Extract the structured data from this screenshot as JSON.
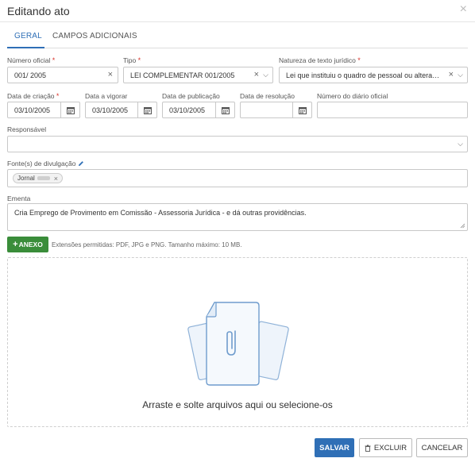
{
  "modal": {
    "title": "Editando ato",
    "close_icon": "×"
  },
  "tabs": [
    {
      "label": "GERAL"
    },
    {
      "label": "CAMPOS ADICIONAIS"
    }
  ],
  "fields": {
    "numero_oficial": {
      "label": "Número oficial",
      "value": "001/ 2005"
    },
    "tipo": {
      "label": "Tipo",
      "value": "LEI COMPLEMENTAR 001/2005"
    },
    "natureza": {
      "label": "Natureza de texto jurídico",
      "value": "Lei que instituiu o quadro de pessoal ou alteraç..."
    },
    "data_criacao": {
      "label": "Data de criação",
      "value": "03/10/2005"
    },
    "data_vigorar": {
      "label": "Data a vigorar",
      "value": "03/10/2005"
    },
    "data_publicacao": {
      "label": "Data de publicação",
      "value": "03/10/2005"
    },
    "data_resolucao": {
      "label": "Data de resolução",
      "value": ""
    },
    "numero_diario": {
      "label": "Número do diário oficial",
      "value": ""
    },
    "responsavel": {
      "label": "Responsável",
      "value": ""
    },
    "fontes": {
      "label": "Fonte(s) de divulgação",
      "tag": "Jornal"
    },
    "ementa": {
      "label": "Ementa",
      "value": "Cria Emprego de Provimento em Comissão - Assessoria Jurídica -  e dá outras providências."
    }
  },
  "upload": {
    "button_label": "ANEXO",
    "hint": "Extensões permitidas: PDF, JPG e PNG. Tamanho máximo: 10 MB.",
    "drop_text": "Arraste e solte arquivos aqui ou selecione-os"
  },
  "footer": {
    "save": "SALVAR",
    "delete": "EXCLUIR",
    "cancel": "CANCELAR"
  },
  "colors": {
    "primary": "#2f6fb6",
    "success": "#3a8d3a",
    "required": "#d9342b"
  }
}
